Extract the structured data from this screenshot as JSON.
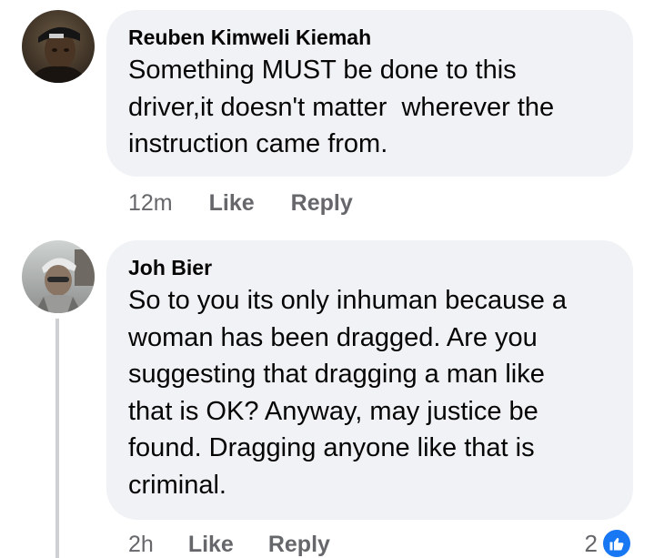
{
  "comments": [
    {
      "author": "Reuben Kimweli Kiemah",
      "avatar": "profile-photo-icon",
      "text_lines": [
        "Something MUST be done to this",
        "driver,it doesn't matter  wherever the",
        "instruction came from."
      ],
      "time": "12m",
      "like_label": "Like",
      "reply_label": "Reply"
    },
    {
      "author": "Joh Bier",
      "avatar": "profile-photo-icon",
      "text_lines": [
        "So to you its only inhuman because a",
        "woman has been dragged. Are you",
        "suggesting that dragging a man like",
        "that is OK? Anyway, may justice be",
        "found. Dragging anyone like that is",
        "criminal."
      ],
      "time": "2h",
      "like_label": "Like",
      "reply_label": "Reply",
      "reaction_count": "2",
      "reaction_icon": "thumbs-up-icon"
    }
  ],
  "colors": {
    "bubble": "#f0f2f5",
    "text": "#050505",
    "secondary": "#65676b",
    "like_blue": "#1877f2",
    "thread_line": "#ced0d4"
  }
}
